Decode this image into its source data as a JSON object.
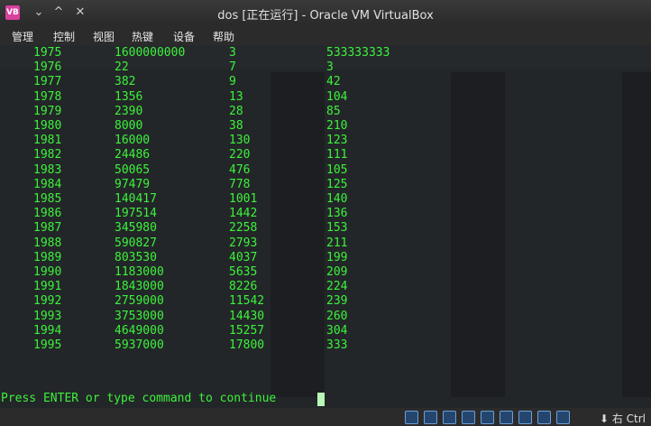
{
  "window": {
    "title": "dos [正在运行] - Oracle VM VirtualBox",
    "icon": "virtualbox-icon"
  },
  "menu": [
    "管理",
    "控制",
    "视图",
    "热键",
    "设备",
    "帮助"
  ],
  "terminal": {
    "rows": [
      [
        "1975",
        "1600000000",
        "3",
        "533333333"
      ],
      [
        "1976",
        "22",
        "7",
        "3"
      ],
      [
        "1977",
        "382",
        "9",
        "42"
      ],
      [
        "1978",
        "1356",
        "13",
        "104"
      ],
      [
        "1979",
        "2390",
        "28",
        "85"
      ],
      [
        "1980",
        "8000",
        "38",
        "210"
      ],
      [
        "1981",
        "16000",
        "130",
        "123"
      ],
      [
        "1982",
        "24486",
        "220",
        "111"
      ],
      [
        "1983",
        "50065",
        "476",
        "105"
      ],
      [
        "1984",
        "97479",
        "778",
        "125"
      ],
      [
        "1985",
        "140417",
        "1001",
        "140"
      ],
      [
        "1986",
        "197514",
        "1442",
        "136"
      ],
      [
        "1987",
        "345980",
        "2258",
        "153"
      ],
      [
        "1988",
        "590827",
        "2793",
        "211"
      ],
      [
        "1989",
        "803530",
        "4037",
        "199"
      ],
      [
        "1990",
        "1183000",
        "5635",
        "209"
      ],
      [
        "1991",
        "1843000",
        "8226",
        "224"
      ],
      [
        "1992",
        "2759000",
        "11542",
        "239"
      ],
      [
        "1993",
        "3753000",
        "14430",
        "260"
      ],
      [
        "1994",
        "4649000",
        "15257",
        "304"
      ],
      [
        "1995",
        "5937000",
        "17800",
        "333"
      ]
    ],
    "prompt": "Press ENTER or type command to continue"
  },
  "statusbar": {
    "host_key": "右 Ctrl",
    "icons": [
      "harddisk-icon",
      "optical-drive-icon",
      "usb-icon",
      "network-icon",
      "shared-folder-icon",
      "display-icon",
      "recording-icon",
      "mouse-integration-icon",
      "keyboard-icon"
    ]
  },
  "colors": {
    "terminal_text": "#3cf23c",
    "terminal_bg": "#050505",
    "chrome": "#2b2b2b"
  }
}
